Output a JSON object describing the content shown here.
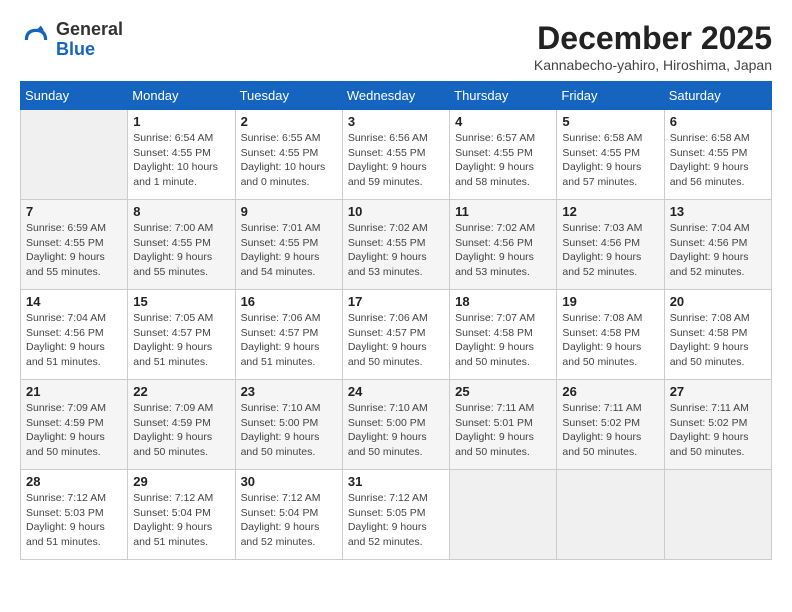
{
  "header": {
    "logo_line1": "General",
    "logo_line2": "Blue",
    "month": "December 2025",
    "location": "Kannabecho-yahiro, Hiroshima, Japan"
  },
  "weekdays": [
    "Sunday",
    "Monday",
    "Tuesday",
    "Wednesday",
    "Thursday",
    "Friday",
    "Saturday"
  ],
  "weeks": [
    [
      {
        "day": "",
        "empty": true
      },
      {
        "day": "1",
        "sunrise": "6:54 AM",
        "sunset": "4:55 PM",
        "daylight": "10 hours and 1 minute."
      },
      {
        "day": "2",
        "sunrise": "6:55 AM",
        "sunset": "4:55 PM",
        "daylight": "10 hours and 0 minutes."
      },
      {
        "day": "3",
        "sunrise": "6:56 AM",
        "sunset": "4:55 PM",
        "daylight": "9 hours and 59 minutes."
      },
      {
        "day": "4",
        "sunrise": "6:57 AM",
        "sunset": "4:55 PM",
        "daylight": "9 hours and 58 minutes."
      },
      {
        "day": "5",
        "sunrise": "6:58 AM",
        "sunset": "4:55 PM",
        "daylight": "9 hours and 57 minutes."
      },
      {
        "day": "6",
        "sunrise": "6:58 AM",
        "sunset": "4:55 PM",
        "daylight": "9 hours and 56 minutes."
      }
    ],
    [
      {
        "day": "7",
        "sunrise": "6:59 AM",
        "sunset": "4:55 PM",
        "daylight": "9 hours and 55 minutes."
      },
      {
        "day": "8",
        "sunrise": "7:00 AM",
        "sunset": "4:55 PM",
        "daylight": "9 hours and 55 minutes."
      },
      {
        "day": "9",
        "sunrise": "7:01 AM",
        "sunset": "4:55 PM",
        "daylight": "9 hours and 54 minutes."
      },
      {
        "day": "10",
        "sunrise": "7:02 AM",
        "sunset": "4:55 PM",
        "daylight": "9 hours and 53 minutes."
      },
      {
        "day": "11",
        "sunrise": "7:02 AM",
        "sunset": "4:56 PM",
        "daylight": "9 hours and 53 minutes."
      },
      {
        "day": "12",
        "sunrise": "7:03 AM",
        "sunset": "4:56 PM",
        "daylight": "9 hours and 52 minutes."
      },
      {
        "day": "13",
        "sunrise": "7:04 AM",
        "sunset": "4:56 PM",
        "daylight": "9 hours and 52 minutes."
      }
    ],
    [
      {
        "day": "14",
        "sunrise": "7:04 AM",
        "sunset": "4:56 PM",
        "daylight": "9 hours and 51 minutes."
      },
      {
        "day": "15",
        "sunrise": "7:05 AM",
        "sunset": "4:57 PM",
        "daylight": "9 hours and 51 minutes."
      },
      {
        "day": "16",
        "sunrise": "7:06 AM",
        "sunset": "4:57 PM",
        "daylight": "9 hours and 51 minutes."
      },
      {
        "day": "17",
        "sunrise": "7:06 AM",
        "sunset": "4:57 PM",
        "daylight": "9 hours and 50 minutes."
      },
      {
        "day": "18",
        "sunrise": "7:07 AM",
        "sunset": "4:58 PM",
        "daylight": "9 hours and 50 minutes."
      },
      {
        "day": "19",
        "sunrise": "7:08 AM",
        "sunset": "4:58 PM",
        "daylight": "9 hours and 50 minutes."
      },
      {
        "day": "20",
        "sunrise": "7:08 AM",
        "sunset": "4:58 PM",
        "daylight": "9 hours and 50 minutes."
      }
    ],
    [
      {
        "day": "21",
        "sunrise": "7:09 AM",
        "sunset": "4:59 PM",
        "daylight": "9 hours and 50 minutes."
      },
      {
        "day": "22",
        "sunrise": "7:09 AM",
        "sunset": "4:59 PM",
        "daylight": "9 hours and 50 minutes."
      },
      {
        "day": "23",
        "sunrise": "7:10 AM",
        "sunset": "5:00 PM",
        "daylight": "9 hours and 50 minutes."
      },
      {
        "day": "24",
        "sunrise": "7:10 AM",
        "sunset": "5:00 PM",
        "daylight": "9 hours and 50 minutes."
      },
      {
        "day": "25",
        "sunrise": "7:11 AM",
        "sunset": "5:01 PM",
        "daylight": "9 hours and 50 minutes."
      },
      {
        "day": "26",
        "sunrise": "7:11 AM",
        "sunset": "5:02 PM",
        "daylight": "9 hours and 50 minutes."
      },
      {
        "day": "27",
        "sunrise": "7:11 AM",
        "sunset": "5:02 PM",
        "daylight": "9 hours and 50 minutes."
      }
    ],
    [
      {
        "day": "28",
        "sunrise": "7:12 AM",
        "sunset": "5:03 PM",
        "daylight": "9 hours and 51 minutes."
      },
      {
        "day": "29",
        "sunrise": "7:12 AM",
        "sunset": "5:04 PM",
        "daylight": "9 hours and 51 minutes."
      },
      {
        "day": "30",
        "sunrise": "7:12 AM",
        "sunset": "5:04 PM",
        "daylight": "9 hours and 52 minutes."
      },
      {
        "day": "31",
        "sunrise": "7:12 AM",
        "sunset": "5:05 PM",
        "daylight": "9 hours and 52 minutes."
      },
      {
        "day": "",
        "empty": true
      },
      {
        "day": "",
        "empty": true
      },
      {
        "day": "",
        "empty": true
      }
    ]
  ],
  "labels": {
    "sunrise": "Sunrise: ",
    "sunset": "Sunset: ",
    "daylight": "Daylight: "
  }
}
